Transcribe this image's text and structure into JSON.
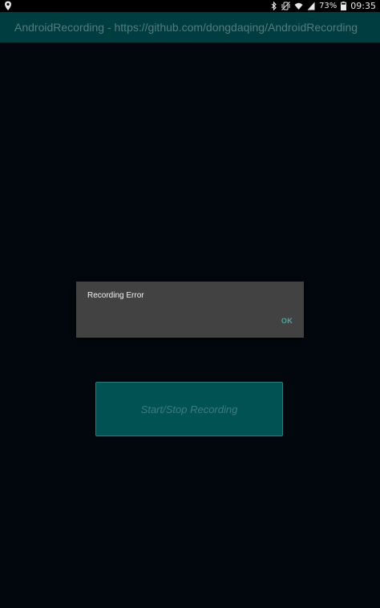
{
  "status_bar": {
    "location_icon": "location-pin-icon",
    "bluetooth_icon": "bluetooth-icon",
    "mute_icon": "vibrate-mute-icon",
    "wifi_icon": "wifi-icon",
    "signal_icon": "cell-signal-icon",
    "battery_percent": "73%",
    "battery_icon": "battery-icon",
    "time": "09:35"
  },
  "action_bar": {
    "title": "AndroidRecording - https://github.com/dongdaqing/AndroidRecording"
  },
  "dialog": {
    "message": "Recording Error",
    "ok_label": "OK"
  },
  "main": {
    "record_button_label": "Start/Stop Recording"
  },
  "colors": {
    "background": "#01070c",
    "action_bar": "#003d40",
    "dialog_bg": "#424242",
    "accent": "#4aa89a",
    "button_bg": "#005253"
  }
}
